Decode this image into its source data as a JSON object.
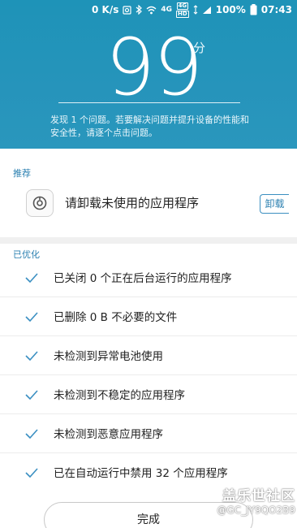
{
  "status_bar": {
    "speed": "0 K/s",
    "net_4g": "4G",
    "lte": "4G",
    "hd": "HD",
    "battery": "100%",
    "time": "07:43"
  },
  "score": {
    "value": "99",
    "unit": "分",
    "description": "发现 1 个问题。若要解决问题并提升设备的性能和安全性，请逐个点击问题。"
  },
  "recommend": {
    "section_label": "推荐",
    "item_text": "请卸载未使用的应用程序",
    "action_label": "卸载"
  },
  "optimized": {
    "section_label": "已优化",
    "items": [
      {
        "text": "已关闭 0 个正在后台运行的应用程序"
      },
      {
        "text": "已删除 0 B 不必要的文件"
      },
      {
        "text": "未检测到异常电池使用"
      },
      {
        "text": "未检测到不稳定的应用程序"
      },
      {
        "text": "未检测到恶意应用程序"
      },
      {
        "text": "已在自动运行中禁用 32 个应用程序"
      }
    ]
  },
  "done_button": "完成",
  "watermark": {
    "brand": "盖乐世社区",
    "user": "@GC_JY9QO2B9"
  },
  "colors": {
    "header_bg": "#2694bb",
    "accent": "#2a7fb0",
    "check": "#3a8fc2"
  }
}
